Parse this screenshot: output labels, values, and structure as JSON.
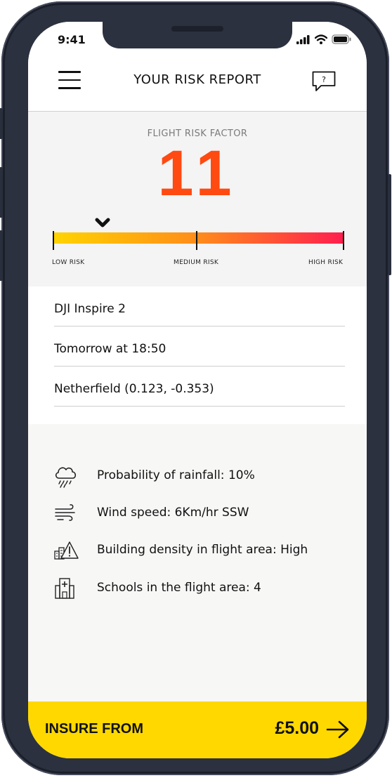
{
  "status_bar": {
    "time": "9:41",
    "icons": [
      "signal-icon",
      "wifi-icon",
      "battery-icon"
    ]
  },
  "header": {
    "title": "YOUR RISK REPORT",
    "menu_icon": "menu-icon",
    "help_icon": "help-chat-icon",
    "help_icon_text": "?"
  },
  "risk": {
    "label": "FLIGHT RISK FACTOR",
    "value": "11",
    "scale_fraction": 0.17,
    "scale_labels": {
      "low": "LOW RISK",
      "medium": "MEDIUM RISK",
      "high": "HIGH RISK"
    },
    "colors": {
      "value": "#ff4a12",
      "low": "#ffd400",
      "medium": "#ff8c1a",
      "high": "#ff1e4f"
    }
  },
  "details": {
    "drone": "DJI Inspire 2",
    "when": "Tomorrow at 18:50",
    "location": "Netherfield (0.123, -0.353)"
  },
  "factors": [
    {
      "icon": "rain-cloud-icon",
      "text": "Probability of rainfall: 10%"
    },
    {
      "icon": "wind-icon",
      "text": "Wind speed: 6Km/hr SSW"
    },
    {
      "icon": "building-warning-icon",
      "text": "Building density in flight area: High"
    },
    {
      "icon": "school-icon",
      "text": "Schools in the flight area: 4"
    }
  ],
  "cta": {
    "label": "INSURE FROM",
    "price": "£5.00",
    "icon": "arrow-right-icon",
    "color": "#ffd800"
  }
}
